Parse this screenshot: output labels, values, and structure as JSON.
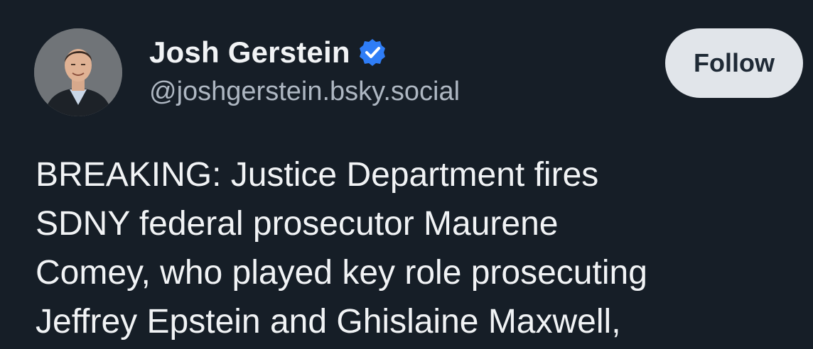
{
  "author": {
    "display_name": "Josh Gerstein",
    "handle": "@joshgerstein.bsky.social",
    "verified_icon": "verified-check-icon",
    "avatar": "profile-photo"
  },
  "actions": {
    "follow_label": "Follow"
  },
  "post": {
    "lines": [
      "BREAKING: Justice Department fires",
      "SDNY federal prosecutor Maurene",
      "Comey, who played key role prosecuting",
      "Jeffrey Epstein and Ghislaine Maxwell,"
    ]
  },
  "colors": {
    "background": "#161e27",
    "text": "#f1f3f5",
    "handle": "#aeb7c2",
    "verified": "#2f7df6",
    "follow_bg": "#e1e5ea"
  }
}
